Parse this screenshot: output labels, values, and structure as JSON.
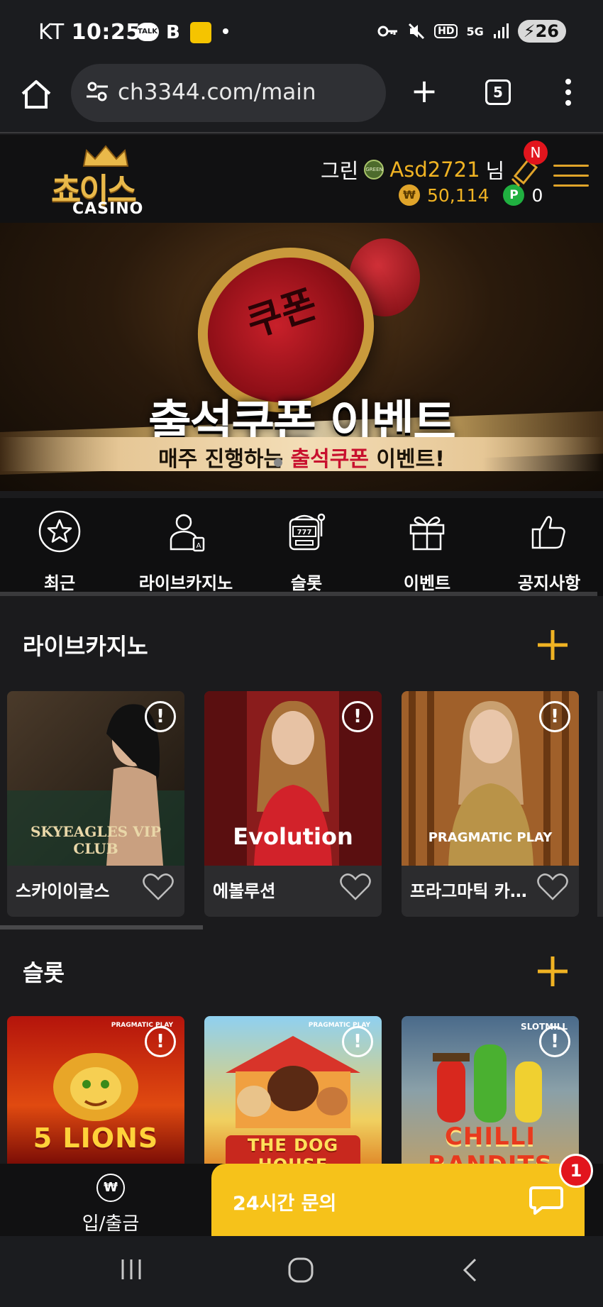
{
  "status_bar": {
    "carrier": "KT",
    "time": "10:25",
    "talk_icon_text": "TALK",
    "b_icon_text": "B",
    "network": "5G",
    "hd": "HD",
    "battery": "26"
  },
  "browser": {
    "url": "ch3344.com/main",
    "tab_count": "5"
  },
  "header": {
    "logo_kr": "쵸이스",
    "logo_en": "CASINO",
    "grade_label": "그린",
    "grade_badge": "GREEN",
    "username": "Asd2721",
    "honorific": "님",
    "coin_symbol": "₩",
    "balance": "50,114",
    "point_symbol": "P",
    "points": "0",
    "notification_badge": "N"
  },
  "banner": {
    "title": "출석쿠폰 이벤트",
    "subtitle_pre": "매주 진행하는 ",
    "subtitle_highlight": "출석쿠폰",
    "subtitle_post": " 이벤트!",
    "stamp_text": "쿠폰"
  },
  "categories": [
    {
      "label": "최근",
      "icon": "star-icon"
    },
    {
      "label": "라이브카지노",
      "icon": "dealer-icon"
    },
    {
      "label": "슬롯",
      "icon": "slot-machine-icon"
    },
    {
      "label": "이벤트",
      "icon": "gift-icon"
    },
    {
      "label": "공지사항",
      "icon": "thumbs-up-icon"
    }
  ],
  "live_casino": {
    "title": "라이브카지노",
    "cards": [
      {
        "name": "스카이이글스",
        "brand": "SKYEAGLES VIP CLUB"
      },
      {
        "name": "에볼루션",
        "brand": "Evolution"
      },
      {
        "name": "프라그마틱 카…",
        "brand": "PRAGMATIC PLAY"
      }
    ],
    "info_symbol": "!"
  },
  "slots": {
    "title": "슬롯",
    "cards": [
      {
        "provider": "PRAGMATIC PLAY",
        "game": "5 LIONS"
      },
      {
        "provider": "PRAGMATIC PLAY",
        "game": "THE DOG HOUSE"
      },
      {
        "provider": "SLOTMILL",
        "game": "CHILLI BANDITS"
      }
    ],
    "info_symbol": "!"
  },
  "bottom_bar": {
    "deposit_label": "입/출금",
    "deposit_symbol": "₩",
    "chat_label": "24시간 문의",
    "chat_badge": "1"
  },
  "colors": {
    "accent_gold": "#f0b323",
    "chat_yellow": "#f6c21a",
    "badge_red": "#e2151d",
    "point_green": "#20b040"
  }
}
